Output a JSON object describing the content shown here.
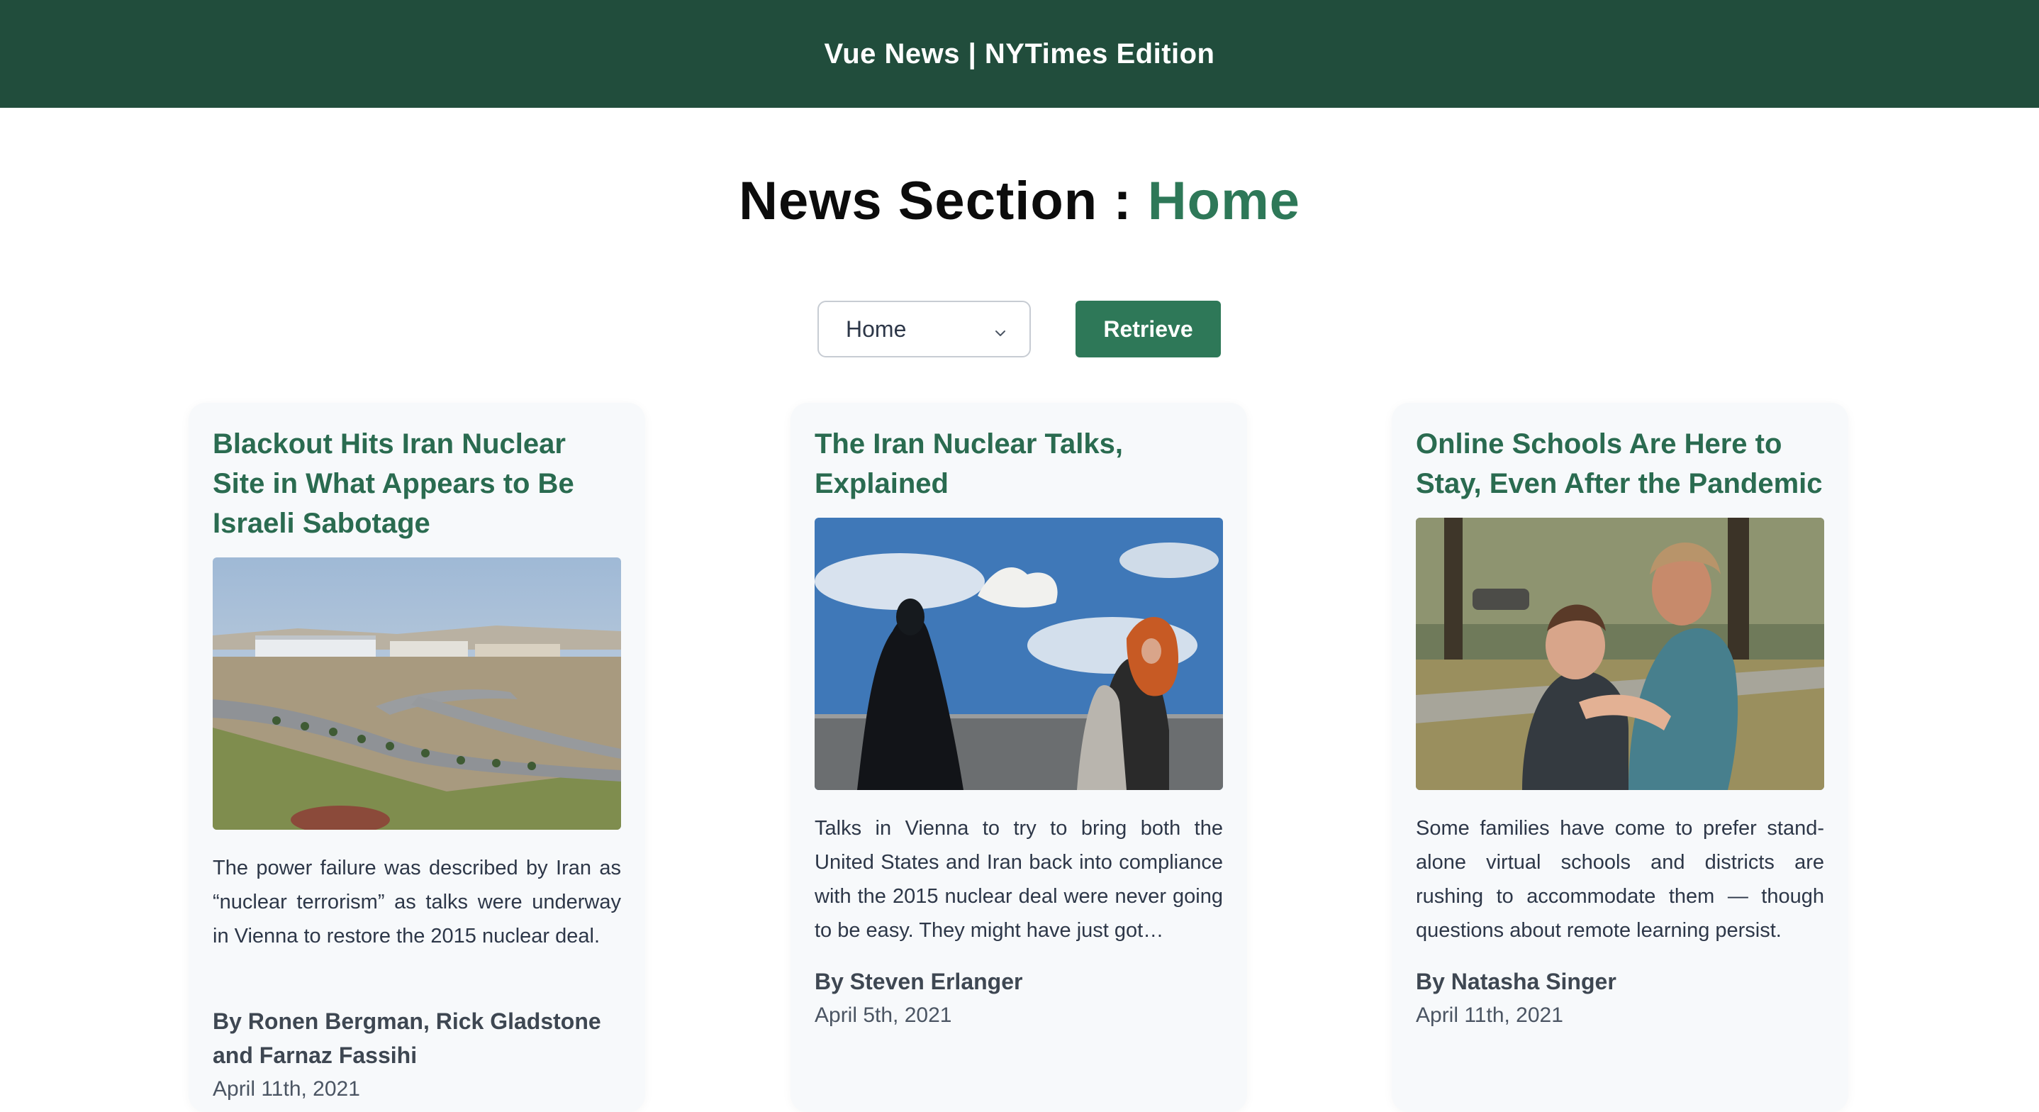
{
  "header": {
    "title": "Vue News | NYTimes Edition"
  },
  "section": {
    "prefix": "News Section : ",
    "name": "Home"
  },
  "controls": {
    "select_value": "Home",
    "retrieve_label": "Retrieve"
  },
  "colors": {
    "header_bg": "#214d3c",
    "accent": "#2e7858",
    "title_green": "#2a6b50"
  },
  "articles": [
    {
      "title": "Blackout Hits Iran Nuclear Site in What Appears to Be Israeli Sabotage",
      "abstract": "The power failure was described by Iran as “nuclear terrorism” as talks were underway in Vienna to restore the 2015 nuclear deal.",
      "byline": "By Ronen Bergman, Rick Gladstone and Farnaz Fassihi",
      "date": "April 11th, 2021",
      "image": "photo of nuclear facility with road and trees"
    },
    {
      "title": "The Iran Nuclear Talks, Explained",
      "abstract": "Talks in Vienna to try to bring both the United States and Iran back into compliance with the 2015 nuclear deal were never going to be easy. They might have just got…",
      "byline": "By Steven Erlanger",
      "date": "April 5th, 2021",
      "image": "photo of women walking past dove mural"
    },
    {
      "title": "Online Schools Are Here to Stay, Even After the Pandemic",
      "abstract": "Some families have come to prefer stand-alone virtual schools and districts are rushing to accommodate them — though questions about remote learning persist.",
      "byline": "By Natasha Singer",
      "date": "April 11th, 2021",
      "image": "photo of mother hugging son in park"
    }
  ]
}
